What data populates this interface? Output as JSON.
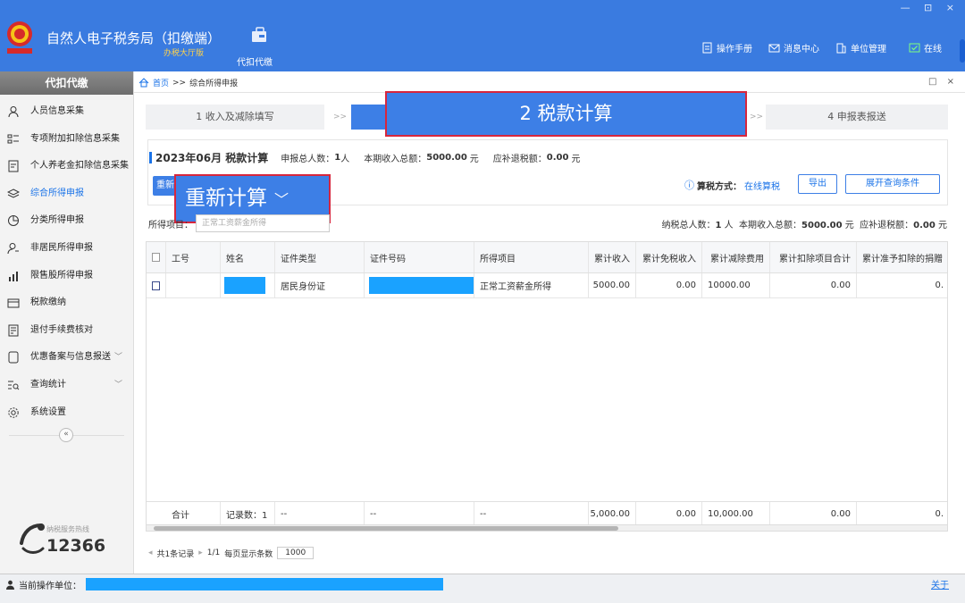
{
  "header": {
    "app_title": "自然人电子税务局（扣缴端）",
    "app_subtitle": "办税大厅版",
    "module_label": "代扣代缴",
    "menu": {
      "manual": "操作手册",
      "messages": "消息中心",
      "unit": "单位管理",
      "online": "在线"
    },
    "window_controls": "— ⊡ ×"
  },
  "sidebar": {
    "title": "代扣代缴",
    "items": [
      {
        "label": "人员信息采集",
        "icon": "person-icon"
      },
      {
        "label": "专项附加扣除信息采集",
        "icon": "list-icon"
      },
      {
        "label": "个人养老金扣除信息采集",
        "icon": "card-icon"
      },
      {
        "label": "综合所得申报",
        "icon": "layers-icon"
      },
      {
        "label": "分类所得申报",
        "icon": "pie-icon"
      },
      {
        "label": "非居民所得申报",
        "icon": "user-outline-icon"
      },
      {
        "label": "限售股所得申报",
        "icon": "bars-icon"
      },
      {
        "label": "税款缴纳",
        "icon": "wallet-icon"
      },
      {
        "label": "退付手续费核对",
        "icon": "receipt-icon"
      },
      {
        "label": "优惠备案与信息报送",
        "icon": "doc-icon"
      },
      {
        "label": "查询统计",
        "icon": "search-list-icon"
      },
      {
        "label": "系统设置",
        "icon": "gear-icon"
      }
    ],
    "collapse_label": "«",
    "hotline_label": "纳税服务热线",
    "hotline_number": "12366"
  },
  "breadcrumb": {
    "home": "首页",
    "sep": ">>",
    "current": "综合所得申报",
    "controls": "□ ×"
  },
  "steps": {
    "step1": "1 收入及减除填写",
    "step2": "2 税款计算",
    "step4": "4 申报表报送",
    "sep": ">>"
  },
  "info": {
    "period": "2023年06月 税款计算",
    "people_label": "申报总人数：",
    "people_value": "1",
    "people_unit": "人",
    "income_label": "本期收入总额：",
    "income_value": "5000.00",
    "income_unit": "元",
    "refund_label": "应补退税额：",
    "refund_value": "0.00",
    "refund_unit": "元",
    "recalc_small": "重新",
    "recalc_zoom": "重新计算",
    "method_label": "算税方式：",
    "method_value": "在线算税",
    "method_icon": "info-circle-icon",
    "export": "导出",
    "expand_query": "展开查询条件"
  },
  "filter": {
    "label": "所得项目：",
    "placeholder": "正常工资薪金所得"
  },
  "summary": {
    "people_label": "纳税总人数：",
    "people_value": "1",
    "people_unit": "人",
    "income_label": "本期收入总额：",
    "income_value": "5000.00",
    "income_unit": "元",
    "refund_label": "应补退税额：",
    "refund_value": "0.00",
    "refund_unit": "元"
  },
  "table": {
    "columns": [
      "工号",
      "姓名",
      "证件类型",
      "证件号码",
      "所得项目",
      "累计收入",
      "累计免税收入",
      "累计减除费用",
      "累计扣除项目合计",
      "累计准予扣除的捐赠"
    ],
    "row": {
      "id": "",
      "name": "",
      "id_type": "居民身份证",
      "id_number": "",
      "income_item": "正常工资薪金所得",
      "cum_income": "5000.00",
      "cum_tax_free": "0.00",
      "cum_deduction": "10000.00",
      "cum_items_total": "0.00",
      "cum_donation": "0."
    },
    "footer": {
      "label": "合计",
      "records": "记录数：1",
      "dash1": "--",
      "dash2": "--",
      "dash3": "--",
      "cum_income": "5,000.00",
      "cum_tax_free": "0.00",
      "cum_deduction": "10,000.00",
      "cum_items_total": "0.00",
      "cum_donation": "0."
    }
  },
  "pager": {
    "text": "共1条记录",
    "page": "1/1",
    "size_label": "每页显示条数",
    "size_value": "1000"
  },
  "status": {
    "label": "当前操作单位：",
    "close": "关于"
  },
  "colors": {
    "header_blue": "#3a7be0",
    "accent": "#1a73e8",
    "highlight_border": "#d7263d",
    "redaction": "#1aa2ff"
  }
}
